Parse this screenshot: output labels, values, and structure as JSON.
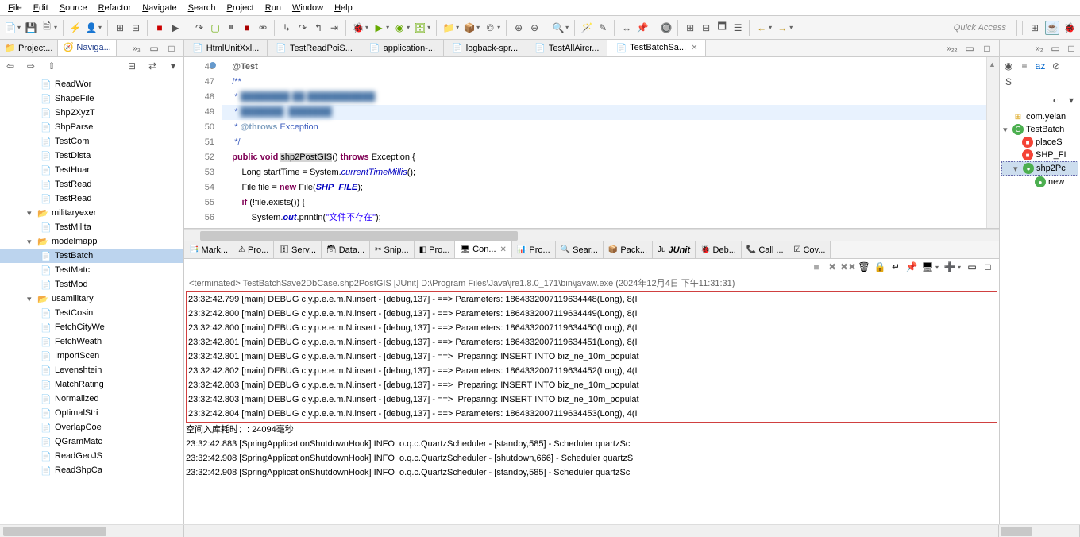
{
  "menu": [
    "File",
    "Edit",
    "Source",
    "Refactor",
    "Navigate",
    "Search",
    "Project",
    "Run",
    "Window",
    "Help"
  ],
  "quick_access": "Quick Access",
  "left_tabs": [
    "Project...",
    "Naviga..."
  ],
  "tree": [
    {
      "t": "file",
      "l": 2,
      "label": "ReadWor"
    },
    {
      "t": "file",
      "l": 2,
      "label": "ShapeFile"
    },
    {
      "t": "file",
      "l": 2,
      "label": "Shp2XyzT"
    },
    {
      "t": "file",
      "l": 2,
      "label": "ShpParse"
    },
    {
      "t": "file",
      "l": 2,
      "label": "TestCom"
    },
    {
      "t": "file",
      "l": 2,
      "label": "TestDista"
    },
    {
      "t": "file",
      "l": 2,
      "label": "TestHuar"
    },
    {
      "t": "file",
      "l": 2,
      "label": "TestRead"
    },
    {
      "t": "file",
      "l": 2,
      "label": "TestRead"
    },
    {
      "t": "folder",
      "l": 1,
      "label": "militaryexer",
      "open": true
    },
    {
      "t": "file",
      "l": 2,
      "label": "TestMilita"
    },
    {
      "t": "folder",
      "l": 1,
      "label": "modelmapp",
      "open": true
    },
    {
      "t": "file",
      "l": 2,
      "label": "TestBatch",
      "sel": true
    },
    {
      "t": "file",
      "l": 2,
      "label": "TestMatc"
    },
    {
      "t": "file",
      "l": 2,
      "label": "TestMod"
    },
    {
      "t": "folder",
      "l": 1,
      "label": "usamilitary",
      "open": true
    },
    {
      "t": "file",
      "l": 2,
      "label": "TestCosin"
    },
    {
      "t": "file",
      "l": 2,
      "label": "FetchCityWe"
    },
    {
      "t": "file",
      "l": 2,
      "label": "FetchWeath"
    },
    {
      "t": "file",
      "l": 2,
      "label": "ImportScen"
    },
    {
      "t": "file",
      "l": 2,
      "label": "Levenshtein"
    },
    {
      "t": "file",
      "l": 2,
      "label": "MatchRating"
    },
    {
      "t": "file",
      "l": 2,
      "label": "Normalized"
    },
    {
      "t": "file",
      "l": 2,
      "label": "OptimalStri"
    },
    {
      "t": "file",
      "l": 2,
      "label": "OverlapCoe"
    },
    {
      "t": "file",
      "l": 2,
      "label": "QGramMatc"
    },
    {
      "t": "file",
      "l": 2,
      "label": "ReadGeoJS"
    },
    {
      "t": "file",
      "l": 2,
      "label": "ReadShpCa"
    }
  ],
  "editor_tabs": [
    {
      "label": "HtmlUnitXxl..."
    },
    {
      "label": "TestReadPoiS..."
    },
    {
      "label": "application-..."
    },
    {
      "label": "logback-spr..."
    },
    {
      "label": "TestAllAircr..."
    },
    {
      "label": "TestBatchSa...",
      "active": true
    }
  ],
  "editor_overflow": "»₂₂",
  "code": {
    "start": 46,
    "lines": [
      {
        "n": 46,
        "html": "    <span class='kw-ann'>@Test</span>",
        "mark": true
      },
      {
        "n": 47,
        "html": "    <span class='kw-doc'>/**</span>"
      },
      {
        "n": 48,
        "html": "     <span class='kw-doc'>* <span style='filter:blur(3px);color:#507aaa'>████████ ██ ███████████</span></span>"
      },
      {
        "n": 49,
        "html": "     <span class='kw-doc'>* <span style='filter:blur(3px);color:#507aaa'>███████  ███████</span></span>",
        "hl": true
      },
      {
        "n": 50,
        "html": "     <span class='kw-doc'>* <span class='kw-doctag'>@throws</span> Exception</span>"
      },
      {
        "n": 51,
        "html": "     <span class='kw-doc'>*/</span>"
      },
      {
        "n": 52,
        "html": "    <span class='kw'>public</span> <span class='kw'>void</span> <span class='hl-method'>shp2PostGIS</span>() <span class='kw'>throws</span> Exception {"
      },
      {
        "n": 53,
        "html": "        Long startTime = System.<span class='kw-it'>currentTimeMillis</span>();"
      },
      {
        "n": 54,
        "html": "        File file = <span class='kw'>new</span> File(<span class='kw-it' style='font-weight:bold'>SHP_FILE</span>);"
      },
      {
        "n": 55,
        "html": "        <span class='kw'>if</span> (!file.exists()) {"
      },
      {
        "n": 56,
        "html": "            System.<span class='kw-it' style='font-weight:bold'>out</span>.println(<span class='kw-str'>\"文件不存在\"</span>);"
      }
    ]
  },
  "bottom_tabs": [
    "Mark...",
    "Pro...",
    "Serv...",
    "Data...",
    "Snip...",
    "Pro...",
    "Con...",
    "Pro...",
    "Sear...",
    "Pack...",
    "JUnit",
    "Deb...",
    "Call ...",
    "Cov..."
  ],
  "bottom_active": 6,
  "console_header": "<terminated> TestBatchSave2DbCase.shp2PostGIS [JUnit] D:\\Program Files\\Java\\jre1.8.0_171\\bin\\javaw.exe (2024年12月4日 下午11:31:31)",
  "console_boxed": [
    "23:32:42.799 [main] DEBUG c.y.p.e.e.m.N.insert - [debug,137] - ==> Parameters: 1864332007119634448(Long), 8(I",
    "23:32:42.800 [main] DEBUG c.y.p.e.e.m.N.insert - [debug,137] - ==> Parameters: 1864332007119634449(Long), 8(I",
    "23:32:42.800 [main] DEBUG c.y.p.e.e.m.N.insert - [debug,137] - ==> Parameters: 1864332007119634450(Long), 8(I",
    "23:32:42.801 [main] DEBUG c.y.p.e.e.m.N.insert - [debug,137] - ==> Parameters: 1864332007119634451(Long), 8(I",
    "23:32:42.801 [main] DEBUG c.y.p.e.e.m.N.insert - [debug,137] - ==>  Preparing: INSERT INTO biz_ne_10m_populat",
    "23:32:42.802 [main] DEBUG c.y.p.e.e.m.N.insert - [debug,137] - ==> Parameters: 1864332007119634452(Long), 4(I",
    "23:32:42.803 [main] DEBUG c.y.p.e.e.m.N.insert - [debug,137] - ==>  Preparing: INSERT INTO biz_ne_10m_populat",
    "23:32:42.803 [main] DEBUG c.y.p.e.e.m.N.insert - [debug,137] - ==>  Preparing: INSERT INTO biz_ne_10m_populat",
    "23:32:42.804 [main] DEBUG c.y.p.e.e.m.N.insert - [debug,137] - ==> Parameters: 1864332007119634453(Long), 4(I"
  ],
  "console_after": [
    "空间入库耗时：: 24094毫秒",
    "23:32:42.883 [SpringApplicationShutdownHook] INFO  o.q.c.QuartzScheduler - [standby,585] - Scheduler quartzSc",
    "23:32:42.908 [SpringApplicationShutdownHook] INFO  o.q.c.QuartzScheduler - [shutdown,666] - Scheduler quartzS",
    "23:32:42.908 [SpringApplicationShutdownHook] INFO  o.q.c.QuartzScheduler - [standby,585] - Scheduler quartzSc"
  ],
  "outline": [
    {
      "l": 1,
      "ico": "pkg",
      "label": "com.yelan"
    },
    {
      "l": 1,
      "ico": "cls",
      "label": "TestBatch",
      "exp": true
    },
    {
      "l": 2,
      "ico": "fld",
      "label": "placeS"
    },
    {
      "l": 2,
      "ico": "fld",
      "label": "SHP_FI"
    },
    {
      "l": 2,
      "ico": "mth",
      "label": "shp2Pc",
      "sel": true,
      "exp": true
    },
    {
      "l": 3,
      "ico": "mth",
      "label": "new"
    }
  ],
  "right_overflow": "»₂"
}
